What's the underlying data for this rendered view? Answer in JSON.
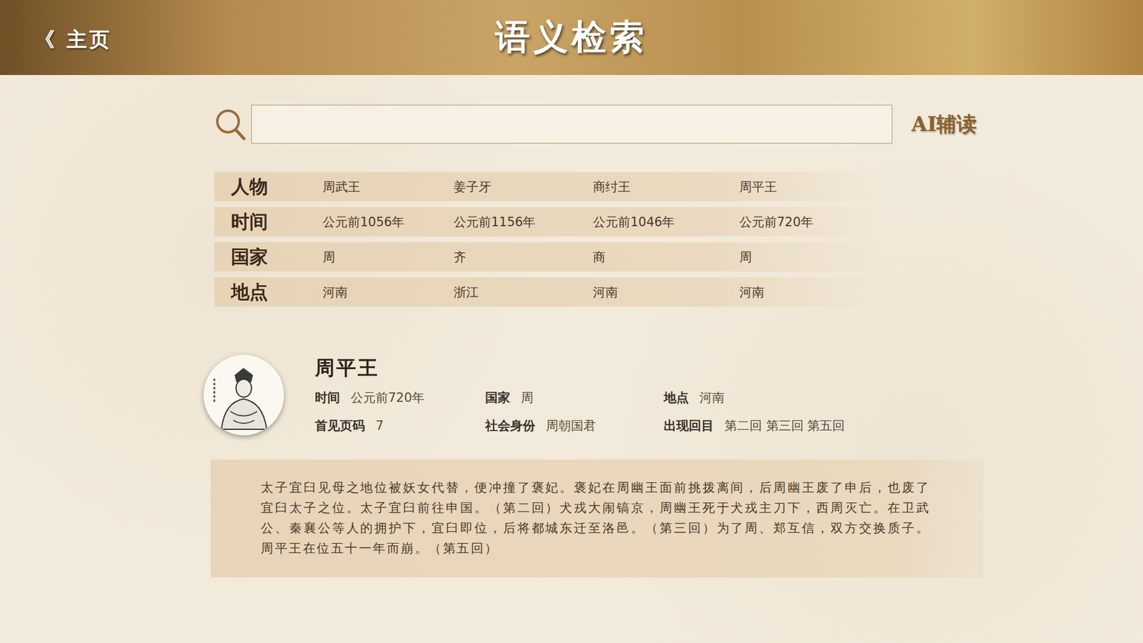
{
  "header": {
    "back": "《 主页",
    "title": "语义检索"
  },
  "search": {
    "ai_button": "AI辅读"
  },
  "facets": [
    {
      "label": "人物",
      "values": [
        "周武王",
        "姜子牙",
        "商纣王",
        "周平王"
      ]
    },
    {
      "label": "时间",
      "values": [
        "公元前1056年",
        "公元前1156年",
        "公元前1046年",
        "公元前720年"
      ]
    },
    {
      "label": "国家",
      "values": [
        "周",
        "齐",
        "商",
        "周"
      ]
    },
    {
      "label": "地点",
      "values": [
        "河南",
        "浙江",
        "河南",
        "河南"
      ]
    }
  ],
  "person": {
    "name": "周平王",
    "fields": [
      {
        "label": "时间",
        "value": "公元前720年"
      },
      {
        "label": "国家",
        "value": "周"
      },
      {
        "label": "地点",
        "value": "河南"
      },
      {
        "label": "首见页码",
        "value": "7"
      },
      {
        "label": "社会身份",
        "value": "周朝国君"
      },
      {
        "label": "出现回目",
        "value": "第二回 第三回 第五回"
      }
    ],
    "description": "太子宜臼见母之地位被妖女代替，便冲撞了褒妃。褒妃在周幽王面前挑拨离间，后周幽王废了申后，也废了宜臼太子之位。太子宜臼前往申国。（第二回）犬戎大闹镐京，周幽王死于犬戎主刀下，西周灭亡。在卫武公、秦襄公等人的拥护下，宜臼即位，后将都城东迁至洛邑。（第三回）为了周、郑互信，双方交换质子。周平王在位五十一年而崩。（第五回）"
  }
}
